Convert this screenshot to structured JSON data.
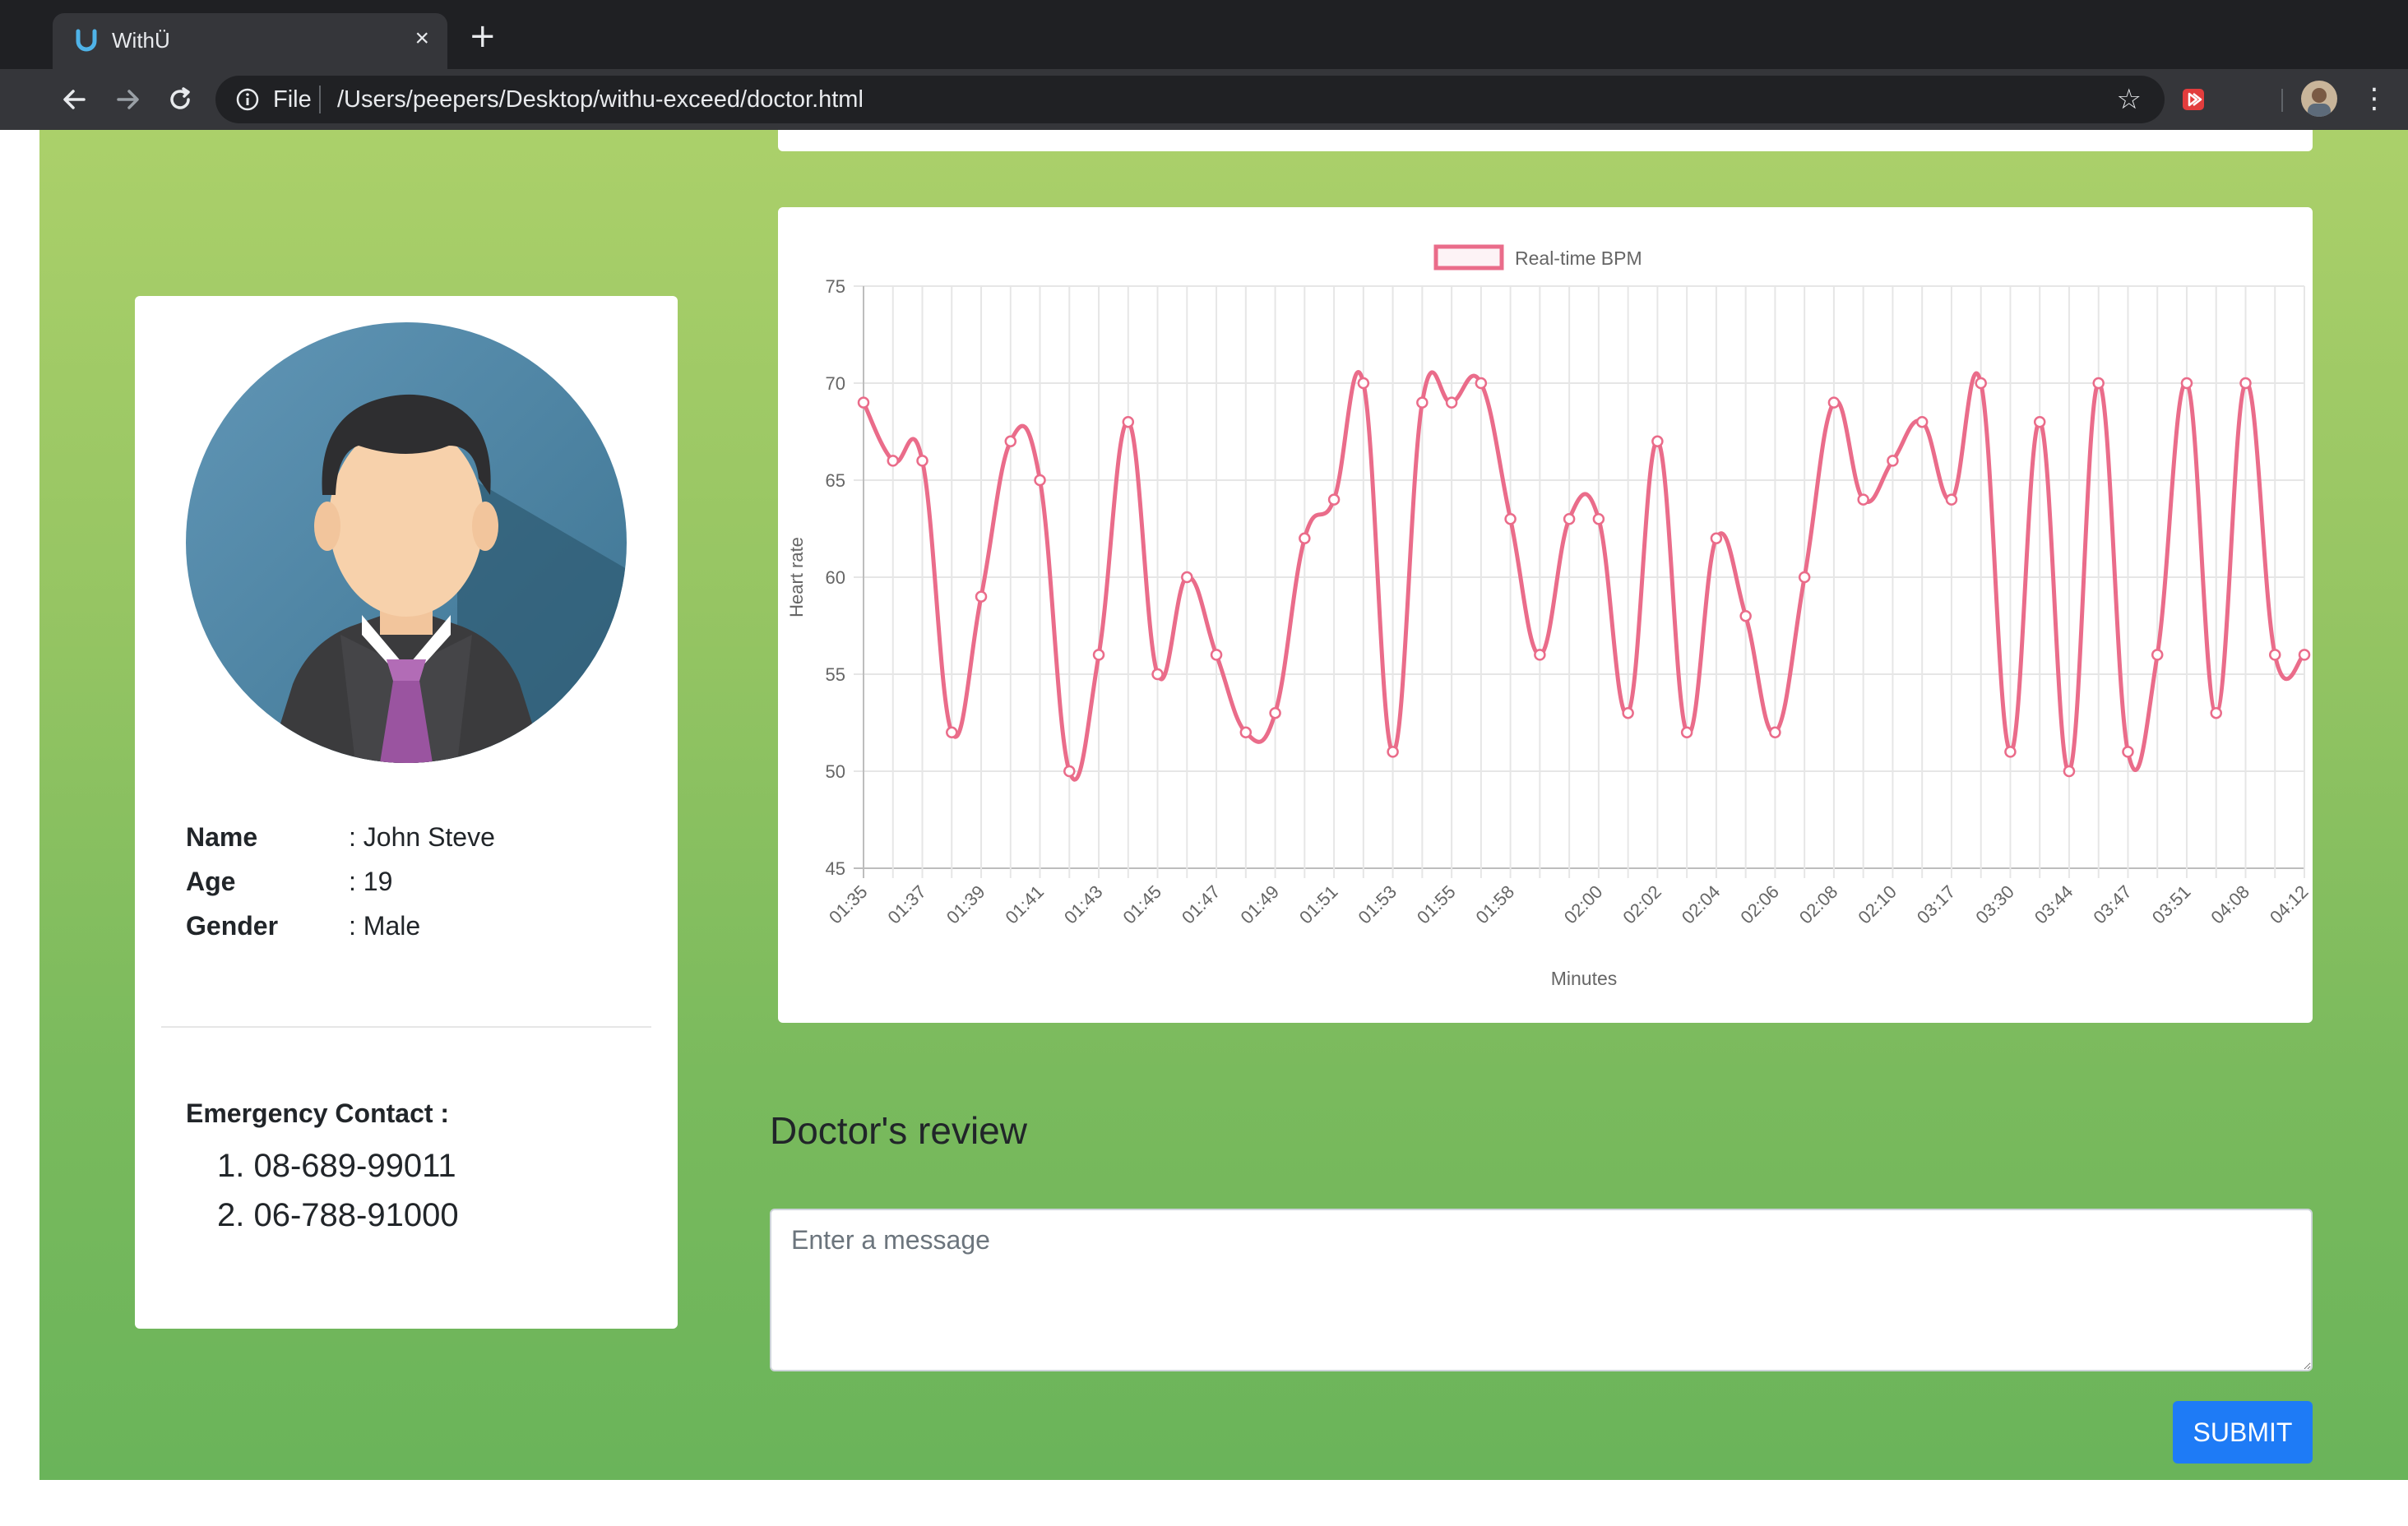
{
  "browser": {
    "tab_title": "WithÜ",
    "url_scheme": "File",
    "url_path": "/Users/peepers/Desktop/withu-exceed/doctor.html",
    "icons": [
      "back-icon",
      "forward-icon",
      "reload-icon",
      "info-icon",
      "star-icon",
      "extension-icon",
      "profile-icon",
      "menu-icon",
      "close-icon",
      "new-tab-icon"
    ]
  },
  "patient": {
    "name_label": "Name",
    "name_value": ": John Steve",
    "age_label": "Age",
    "age_value": ": 19",
    "gender_label": "Gender",
    "gender_value": ": Male",
    "emergency_title": "Emergency Contact :",
    "contacts": [
      "1. 08-689-99011",
      "2. 06-788-91000"
    ]
  },
  "review": {
    "title": "Doctor's review",
    "placeholder": "Enter a message",
    "submit_label": "SUBMIT"
  },
  "colors": {
    "line": "#ea6c8a",
    "button": "#1e7bf6",
    "page_gradient_top": "#abd06a",
    "page_gradient_bottom": "#6ab45a"
  },
  "chart_data": {
    "type": "line",
    "xlabel": "Minutes",
    "ylabel": "Heart rate",
    "ylim": [
      45,
      75
    ],
    "yticks": [
      45,
      50,
      55,
      60,
      65,
      70,
      75
    ],
    "grid": true,
    "legend_position": "top",
    "series": [
      {
        "name": "Real-time BPM",
        "color": "#ea6c8a",
        "values": [
          69,
          66,
          66,
          52,
          59,
          67,
          65,
          50,
          56,
          68,
          55,
          60,
          56,
          52,
          53,
          62,
          64,
          70,
          51,
          69,
          69,
          70,
          63,
          56,
          63,
          63,
          53,
          67,
          52,
          62,
          58,
          52,
          60,
          69,
          64,
          66,
          68,
          64,
          70,
          51,
          68,
          50,
          70,
          51,
          56,
          70,
          53,
          70,
          56,
          56
        ]
      }
    ],
    "x_tick_labels": [
      "01:35",
      "01:37",
      "01:39",
      "01:41",
      "01:43",
      "01:45",
      "01:47",
      "01:49",
      "01:51",
      "01:53",
      "01:55",
      "01:58",
      "02:00",
      "02:02",
      "02:04",
      "02:06",
      "02:08",
      "02:10",
      "03:17",
      "03:30",
      "03:44",
      "03:47",
      "03:51",
      "04:08",
      "04:12"
    ]
  }
}
